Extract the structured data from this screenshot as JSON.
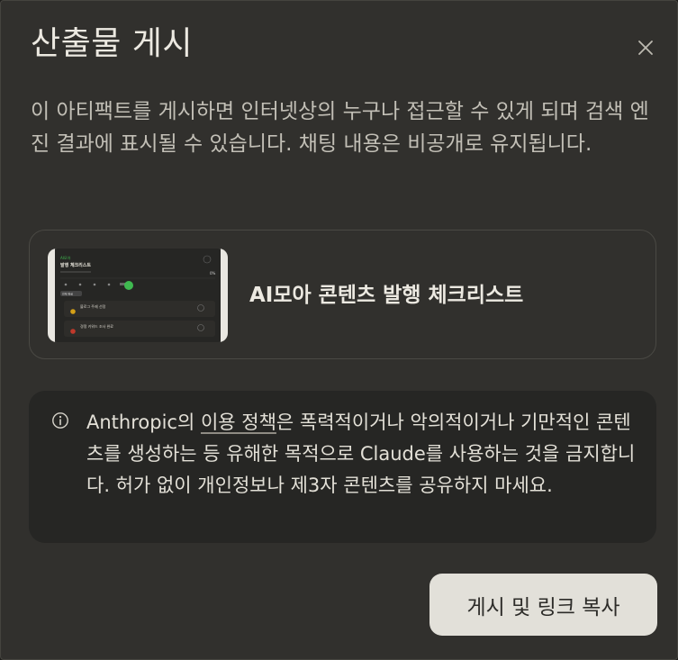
{
  "dialog": {
    "title": "산출물 게시",
    "close_icon": "close-icon",
    "description": "이 아티팩트를 게시하면 인터넷상의 누구나 접근할 수 있게 되며 검색 엔진 결과에 표시될 수 있습니다. 채팅 내용은 비공개로 유지됩니다."
  },
  "artifact_card": {
    "title": "AI모아 콘텐츠 발행 체크리스트",
    "thumbnail": {
      "header_tag": "AI모아",
      "heading": "발행 체크리스트",
      "percent": "0%",
      "chip": "전체 완료",
      "row1": "블로그 주제 선정",
      "row2": "경쟁 키워드 조사 완료"
    }
  },
  "notice": {
    "icon": "info-icon",
    "text_before": "Anthropic의 ",
    "link_text": "이용 정책",
    "text_after": "은 폭력적이거나 악의적이거나 기만적인 콘텐츠를 생성하는 등 유해한 목적으로 Claude를 사용하는 것을 금지합니다. 허가 없이 개인정보나 제3자 콘텐츠를 공유하지 마세요."
  },
  "actions": {
    "publish_label": "게시 및 링크 복사"
  },
  "colors": {
    "dialog_bg": "#31302d",
    "notice_bg": "#262624",
    "button_bg": "#e2e0d9",
    "accent_green": "#3fb950"
  }
}
